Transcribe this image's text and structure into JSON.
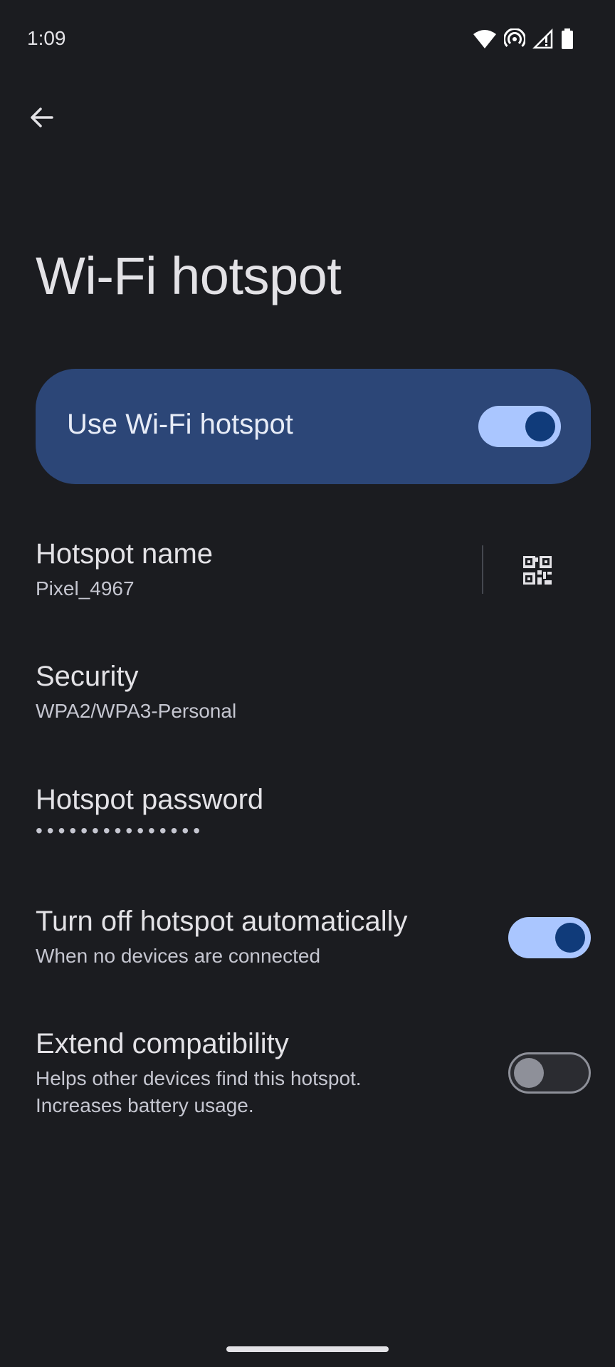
{
  "status_bar": {
    "time": "1:09",
    "icons": [
      "wifi-icon",
      "hotspot-icon",
      "cell-signal-icon",
      "battery-icon"
    ]
  },
  "toolbar": {
    "back_icon": "arrow-back-icon"
  },
  "page": {
    "title": "Wi-Fi hotspot"
  },
  "main_switch": {
    "label": "Use Wi-Fi hotspot",
    "checked": true
  },
  "preferences": {
    "hotspot_name": {
      "title": "Hotspot name",
      "summary": "Pixel_4967",
      "action_icon": "qr-code-icon"
    },
    "security": {
      "title": "Security",
      "summary": "WPA2/WPA3-Personal"
    },
    "password": {
      "title": "Hotspot password",
      "summary": "•••••••••••••••"
    },
    "auto_off": {
      "title": "Turn off hotspot automatically",
      "summary": "When no devices are connected",
      "checked": true
    },
    "extend_compat": {
      "title": "Extend compatibility",
      "summary_line1": "Helps other devices find this hotspot.",
      "summary_line2": "Increases battery usage.",
      "checked": false
    }
  },
  "colors": {
    "background": "#1b1c20",
    "card": "#2c4677",
    "toggle_on_track": "#aac6ff",
    "toggle_on_thumb": "#103b7a",
    "toggle_off_outline": "#8e9099"
  }
}
